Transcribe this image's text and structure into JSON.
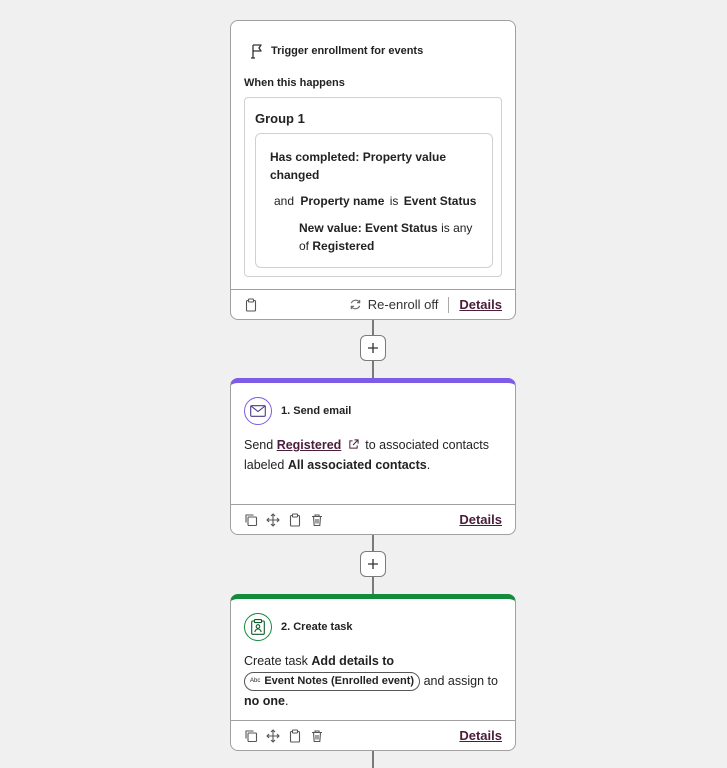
{
  "trigger": {
    "header": "Trigger enrollment for events",
    "when_label": "When this happens",
    "group_title": "Group 1",
    "condition": "Has completed: Property value changed",
    "and_word": "and",
    "prop_name_label": "Property name",
    "is_word": "is",
    "prop_name_value": "Event Status",
    "new_value_label": "New value: Event Status",
    "is_any_of": "is any of",
    "new_value_value": "Registered",
    "reenroll_label": "Re-enroll off",
    "details_label": "Details"
  },
  "steps": [
    {
      "title": "1. Send email",
      "send_word": "Send",
      "email_link": "Registered",
      "to_text": "to associated contacts labeled",
      "label_value": "All associated contacts",
      "period": ".",
      "details_label": "Details",
      "icon": "envelope-icon",
      "accent": "#7e5ce6"
    },
    {
      "title": "2. Create task",
      "create_word": "Create task",
      "task_name": "Add details to",
      "token_abc": "Abc",
      "token_label": "Event Notes (Enrolled event)",
      "assign_text": "and assign to",
      "assignee": "no one",
      "period": ".",
      "details_label": "Details",
      "icon": "task-icon",
      "accent": "#148a3c"
    }
  ],
  "colors": {
    "background": "#f0f0f0",
    "email_accent": "#7e5ce6",
    "task_accent": "#148a3c",
    "link": "#4a1d3a"
  }
}
